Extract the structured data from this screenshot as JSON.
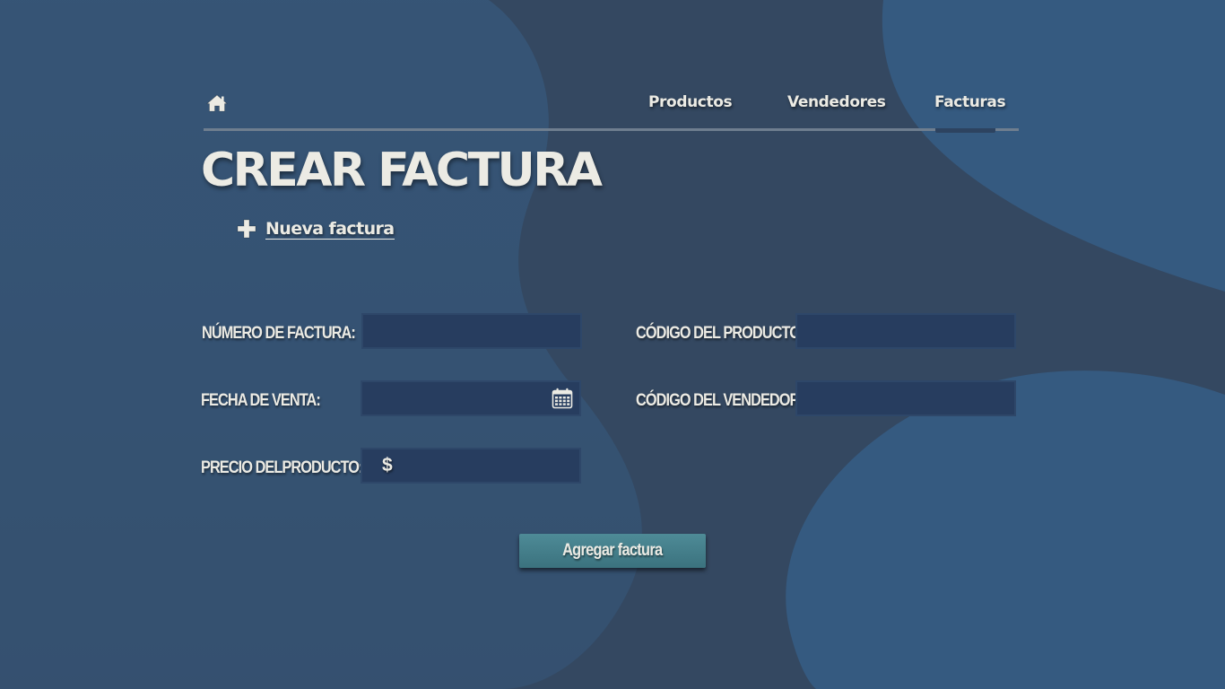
{
  "nav": {
    "home_icon": "home-icon",
    "links": [
      {
        "label": "Productos"
      },
      {
        "label": "Vendedores"
      },
      {
        "label": "Facturas",
        "active": true
      }
    ]
  },
  "page": {
    "title": "CREAR FACTURA",
    "new_invoice": {
      "icon": "plus-icon",
      "label": "Nueva factura"
    }
  },
  "form": {
    "invoice_number": {
      "label": "NÚMERO DE FACTURA:",
      "value": ""
    },
    "product_code": {
      "label": "CÓDIGO DEL PRODUCTO:",
      "value": ""
    },
    "sale_date": {
      "label": "FECHA DE VENTA:",
      "value": "",
      "icon": "calendar-icon"
    },
    "seller_code": {
      "label": "CÓDIGO DEL VENDEDOR:",
      "value": ""
    },
    "product_price": {
      "label": "PRECIO DELPRODUCTO:",
      "prefix": "$",
      "value": ""
    },
    "submit_label": "Agregar factura"
  },
  "colors": {
    "background": "#344a62",
    "accent_blob": "#365b82",
    "text": "#ecebe4",
    "input_bg": "#273d5f",
    "button": "#437e8a"
  }
}
